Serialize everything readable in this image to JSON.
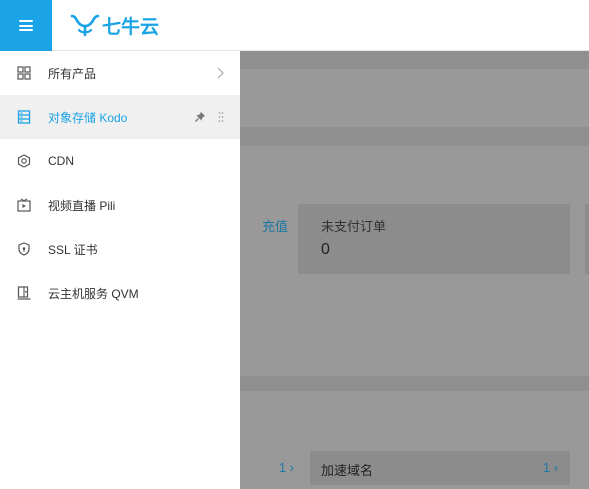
{
  "header": {
    "logo_text": "七牛云",
    "menu_icon": "hamburger-icon",
    "brand_color": "#1aa3e6"
  },
  "sidebar": {
    "items": [
      {
        "label": "所有产品",
        "icon": "grid-icon"
      },
      {
        "label": "对象存储 Kodo",
        "icon": "storage-icon",
        "active": true
      },
      {
        "label": "CDN",
        "icon": "cdn-icon"
      },
      {
        "label": "视频直播 Pili",
        "icon": "live-tv-icon"
      },
      {
        "label": "SSL 证书",
        "icon": "shield-icon"
      },
      {
        "label": "云主机服务 QVM",
        "icon": "server-icon"
      }
    ]
  },
  "background": {
    "recharge_link": "充值",
    "unpaid_orders": {
      "label": "未支付订单",
      "value": "0"
    },
    "row_left": {
      "count": "1"
    },
    "row_domains": {
      "name": "加速域名",
      "count": "1"
    }
  }
}
